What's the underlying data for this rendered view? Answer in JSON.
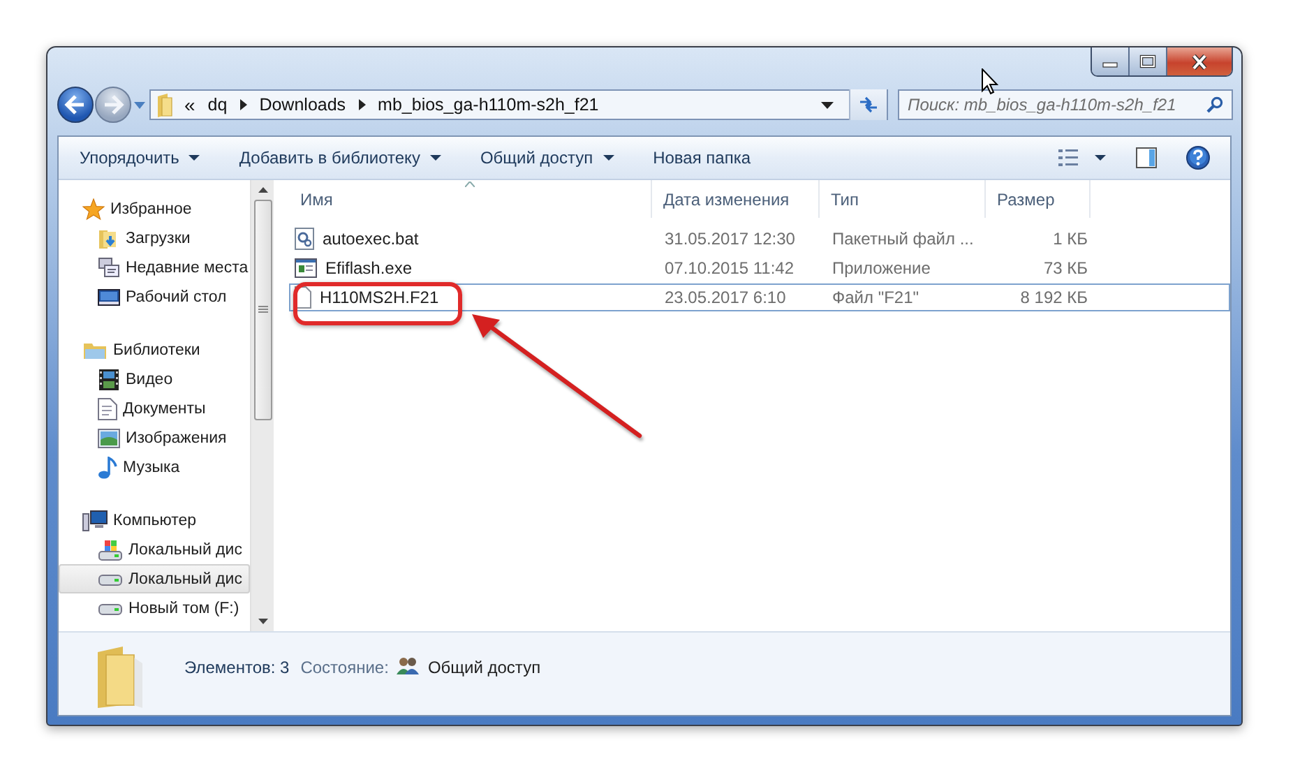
{
  "address": {
    "overflow": "«",
    "path": [
      "dq",
      "Downloads",
      "mb_bios_ga-h110m-s2h_f21"
    ]
  },
  "search": {
    "placeholder": "Поиск: mb_bios_ga-h110m-s2h_f21"
  },
  "toolbar": [
    {
      "label": "Упорядочить",
      "dropdown": true
    },
    {
      "label": "Добавить в библиотеку",
      "dropdown": true
    },
    {
      "label": "Общий доступ",
      "dropdown": true
    },
    {
      "label": "Новая папка",
      "dropdown": false
    }
  ],
  "sidebar": [
    {
      "label": "Избранное",
      "kind": "favorites",
      "selected": false,
      "children": [
        {
          "label": "Загрузки",
          "kind": "downloads",
          "selected": false
        },
        {
          "label": "Недавние места",
          "kind": "recent",
          "selected": false
        },
        {
          "label": "Рабочий стол",
          "kind": "desktop",
          "selected": false
        }
      ]
    },
    {
      "label": "Библиотеки",
      "kind": "libraries",
      "selected": false,
      "children": [
        {
          "label": "Видео",
          "kind": "video",
          "selected": false
        },
        {
          "label": "Документы",
          "kind": "documents",
          "selected": false
        },
        {
          "label": "Изображения",
          "kind": "images",
          "selected": false
        },
        {
          "label": "Музыка",
          "kind": "music",
          "selected": false
        }
      ]
    },
    {
      "label": "Компьютер",
      "kind": "computer",
      "selected": false,
      "children": [
        {
          "label": "Локальный дис",
          "kind": "system-drive",
          "selected": false
        },
        {
          "label": "Локальный дис",
          "kind": "drive",
          "selected": true
        },
        {
          "label": "Новый том (F:)",
          "kind": "drive",
          "selected": false
        }
      ]
    }
  ],
  "table": {
    "columns": [
      {
        "label": "Имя",
        "sorted": true
      },
      {
        "label": "Дата изменения",
        "sorted": false
      },
      {
        "label": "Тип",
        "sorted": false
      },
      {
        "label": "Размер",
        "sorted": false
      }
    ],
    "rows": [
      {
        "name": "autoexec.bat",
        "kind": "batch",
        "date": "31.05.2017 12:30",
        "type": "Пакетный файл ...",
        "size": "1 КБ",
        "selected": false
      },
      {
        "name": "Efiflash.exe",
        "kind": "app",
        "date": "07.10.2015 11:42",
        "type": "Приложение",
        "size": "73 КБ",
        "selected": false
      },
      {
        "name": "H110MS2H.F21",
        "kind": "file",
        "date": "23.05.2017 6:10",
        "type": "Файл \"F21\"",
        "size": "8 192 КБ",
        "selected": true
      }
    ]
  },
  "annotation": {
    "kind": "highlight-arrow"
  },
  "status_bar": {
    "count": "Элементов: 3",
    "state_label": "Состояние:",
    "state": "Общий доступ"
  }
}
